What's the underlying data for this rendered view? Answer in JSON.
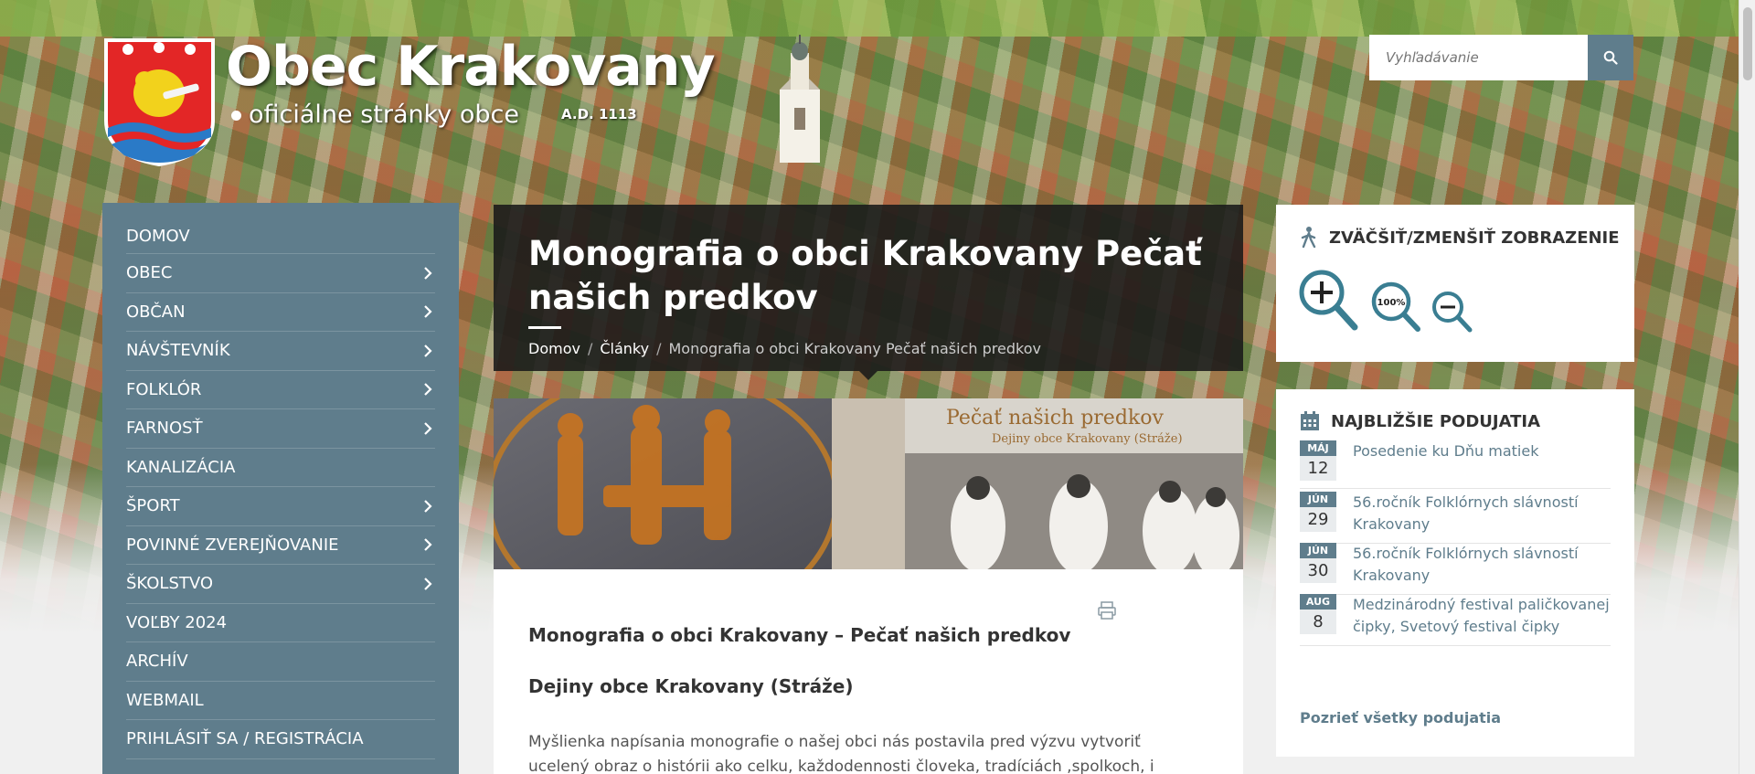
{
  "header": {
    "title": "Obec Krakovany",
    "subtitle": "oficiálne stránky obce",
    "year": "A.D. 1113"
  },
  "search": {
    "placeholder": "Vyhľadávanie",
    "icon": "search-icon"
  },
  "nav": {
    "items": [
      {
        "label": "DOMOV",
        "has_submenu": false
      },
      {
        "label": "OBEC",
        "has_submenu": true
      },
      {
        "label": "OBČAN",
        "has_submenu": true
      },
      {
        "label": "NÁVŠTEVNÍK",
        "has_submenu": true
      },
      {
        "label": "FOLKLÓR",
        "has_submenu": true
      },
      {
        "label": "FARNOSŤ",
        "has_submenu": true
      },
      {
        "label": "KANALIZÁCIA",
        "has_submenu": false
      },
      {
        "label": "ŠPORT",
        "has_submenu": true
      },
      {
        "label": "POVINNÉ ZVEREJŇOVANIE",
        "has_submenu": true
      },
      {
        "label": "ŠKOLSTVO",
        "has_submenu": true
      },
      {
        "label": "VOĽBY 2024",
        "has_submenu": false
      },
      {
        "label": "ARCHÍV",
        "has_submenu": false
      },
      {
        "label": "WEBMAIL",
        "has_submenu": false
      },
      {
        "label": "PRIHLÁSIŤ SA / REGISTRÁCIA",
        "has_submenu": false
      }
    ]
  },
  "page": {
    "title": "Monografia o obci Krakovany Pečať našich predkov",
    "breadcrumb": [
      "Domov",
      "Články",
      "Monografia o obci Krakovany Pečať našich predkov"
    ],
    "banner": {
      "title": "Pečať našich predkov",
      "subtitle": "Dejiny obce Krakovany (Stráže)"
    }
  },
  "article": {
    "heading": "Monografia o obci Krakovany – Pečať našich predkov",
    "subheading": "Dejiny obce Krakovany (Stráže)",
    "paragraph": "Myšlienka napísania monografie o našej obci nás postavila pred výzvu vytvoriť ucelený obraz o histórii ako celku, každodennosti človeka, tradíciách ,spolkoch, i športe. Pri",
    "print_icon": "print-icon"
  },
  "zoom_widget": {
    "title": "Zväčšiť/zmenšiť zobrazenie",
    "zoom_label": "100%"
  },
  "events_widget": {
    "title": "Najbližšie podujatia",
    "events": [
      {
        "month": "MÁJ",
        "day": "12",
        "title": "Posedenie ku Dňu matiek"
      },
      {
        "month": "JÚN",
        "day": "29",
        "title": "56.ročník Folklórnych slávností Krakovany"
      },
      {
        "month": "JÚN",
        "day": "30",
        "title": "56.ročník Folklórnych slávností Krakovany"
      },
      {
        "month": "AUG",
        "day": "8",
        "title": "Medzinárodný festival paličkovanej čipky, Svetový festival čipky"
      }
    ],
    "all_link": "Pozrieť všetky podujatia"
  },
  "colors": {
    "accent": "#5f7d8c",
    "header_overlay": "#191919",
    "link": "#5f7d8c"
  }
}
